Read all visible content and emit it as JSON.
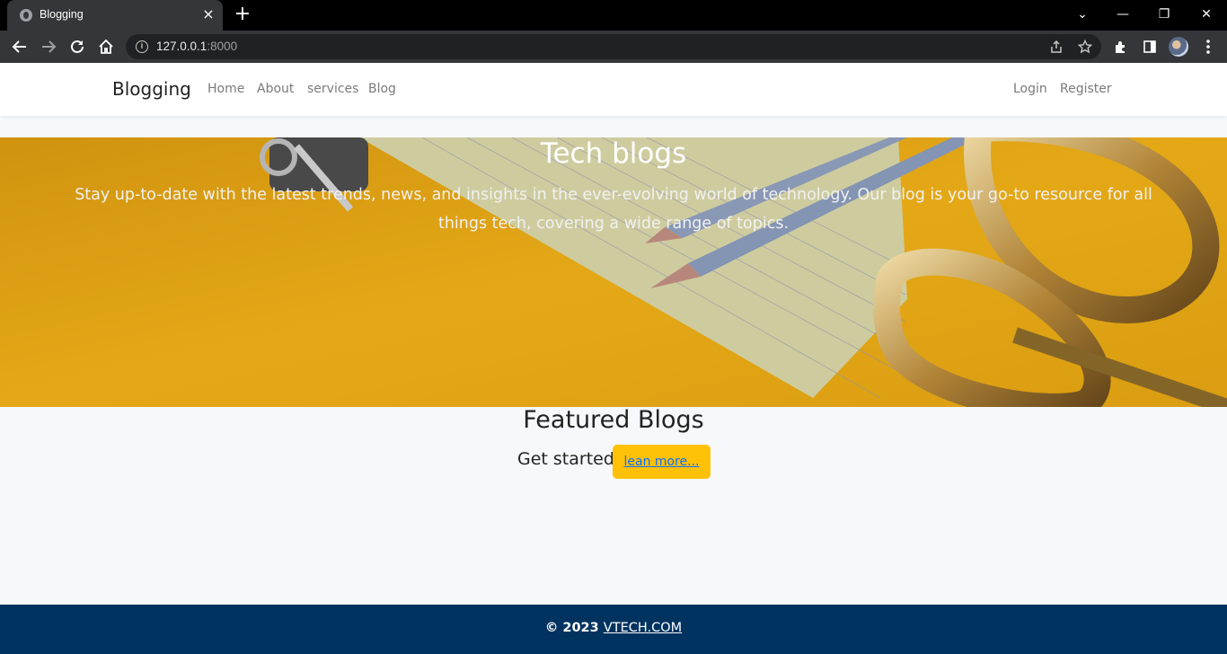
{
  "browser": {
    "tab_title": "Blogging",
    "tab_close": "×",
    "new_tab": "+",
    "url_host": "127.0.0.1",
    "url_port": ":8000",
    "window_controls": {
      "dropdown": "⌄",
      "minimize": "—",
      "restore": "❐",
      "close": "✕"
    }
  },
  "navbar": {
    "brand": "Blogging",
    "links": [
      {
        "label": "Home"
      },
      {
        "label": "About"
      },
      {
        "label": "services"
      },
      {
        "label": "Blog"
      }
    ],
    "auth": {
      "login": "Login",
      "register": "Register"
    }
  },
  "hero": {
    "title": "Tech blogs",
    "text": "Stay up-to-date with the latest trends, news, and insights in the ever-evolving world of technology. Our blog is your go-to resource for all things tech, covering a wide range of topics."
  },
  "featured": {
    "title": "Featured Blogs",
    "get_started": "Get started",
    "learn_more": "lean more..."
  },
  "footer": {
    "copyright": "© 2023",
    "link": "VTECH.COM"
  },
  "colors": {
    "hero_bg": "#e9a814",
    "button_bg": "#ffc107",
    "footer_bg": "#003360",
    "link": "#0d6efd"
  },
  "icons": [
    "globe-icon",
    "back-icon",
    "forward-icon",
    "reload-icon",
    "home-icon",
    "info-icon",
    "share-icon",
    "star-icon",
    "extensions-icon",
    "side-panel-icon",
    "profile-avatar",
    "menu-icon"
  ]
}
